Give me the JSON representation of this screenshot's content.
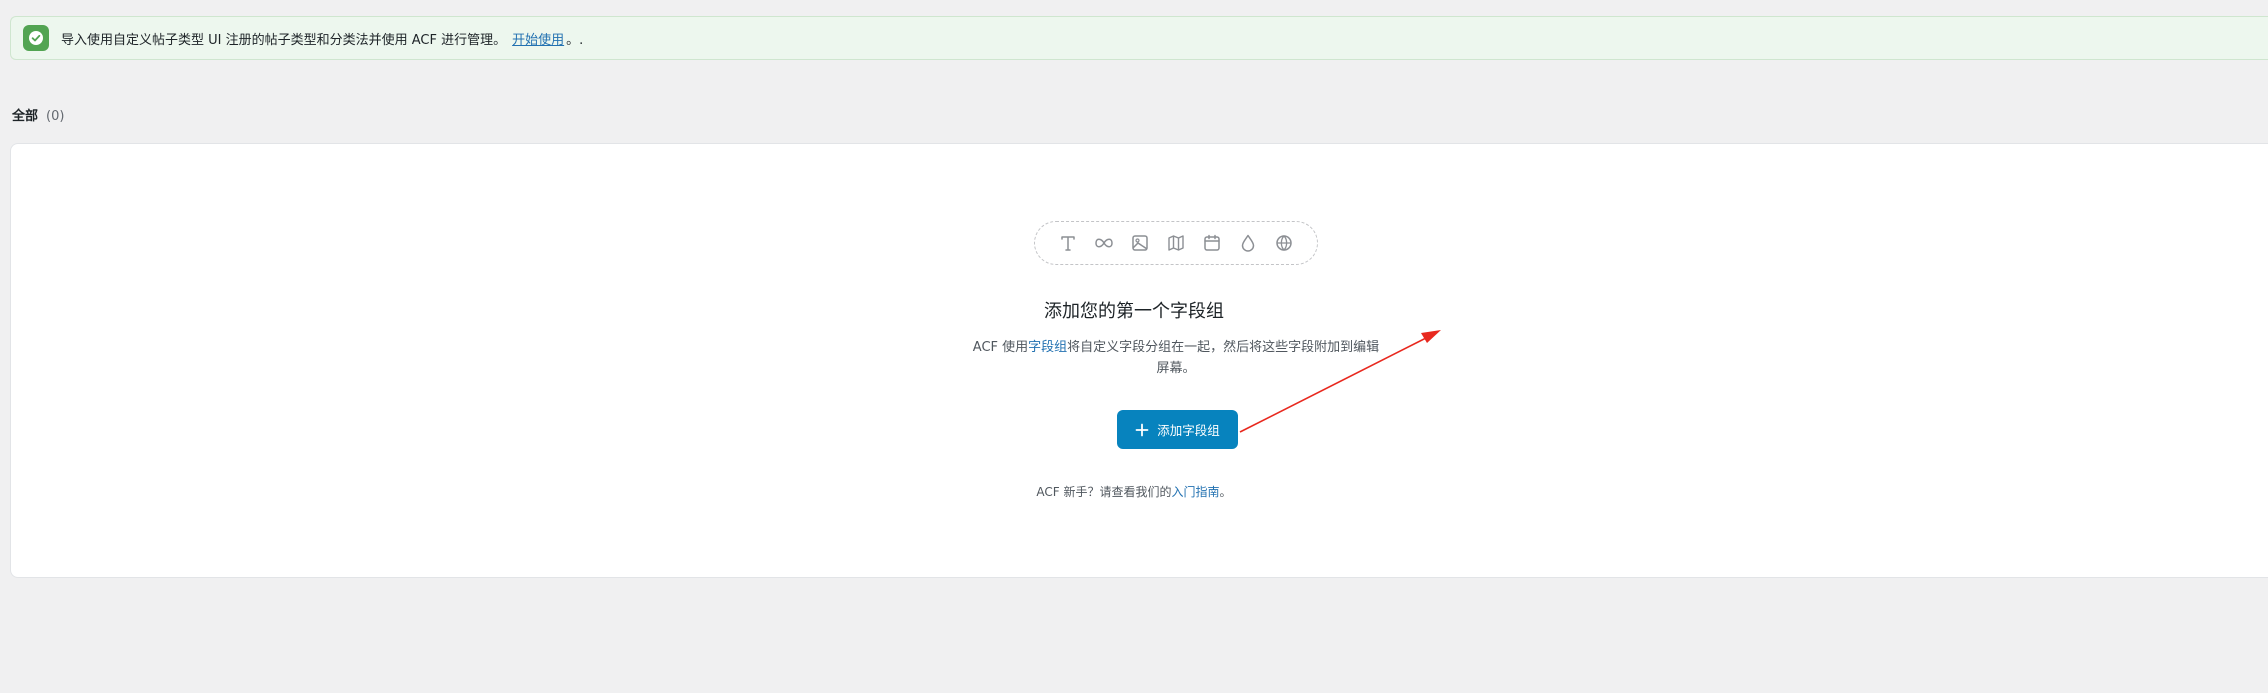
{
  "notice": {
    "icon": "check-circle-icon",
    "text": "导入使用自定义帖子类型 UI 注册的帖子类型和分类法并使用 ACF 进行管理。",
    "link_text": "开始使用",
    "trailing": "。.",
    "color_bg": "#edf7ee",
    "color_icon": "#52a452"
  },
  "filters": {
    "all_label": "全部",
    "all_count": "(0)"
  },
  "empty_state": {
    "icons": [
      "text-icon",
      "infinity-icon",
      "image-icon",
      "map-icon",
      "calendar-icon",
      "droplet-icon",
      "globe-icon"
    ],
    "title": "添加您的第一个字段组",
    "desc_prefix": "ACF 使用",
    "desc_link": "字段组",
    "desc_suffix": "将自定义字段分组在一起，然后将这些字段附加到编辑屏幕。",
    "button_label": "添加字段组",
    "help_prefix": "ACF 新手？请查看我们的",
    "help_link": "入门指南",
    "help_suffix": "。",
    "accent": "#0783be"
  },
  "annotation": {
    "arrow_color": "#e8281e"
  }
}
